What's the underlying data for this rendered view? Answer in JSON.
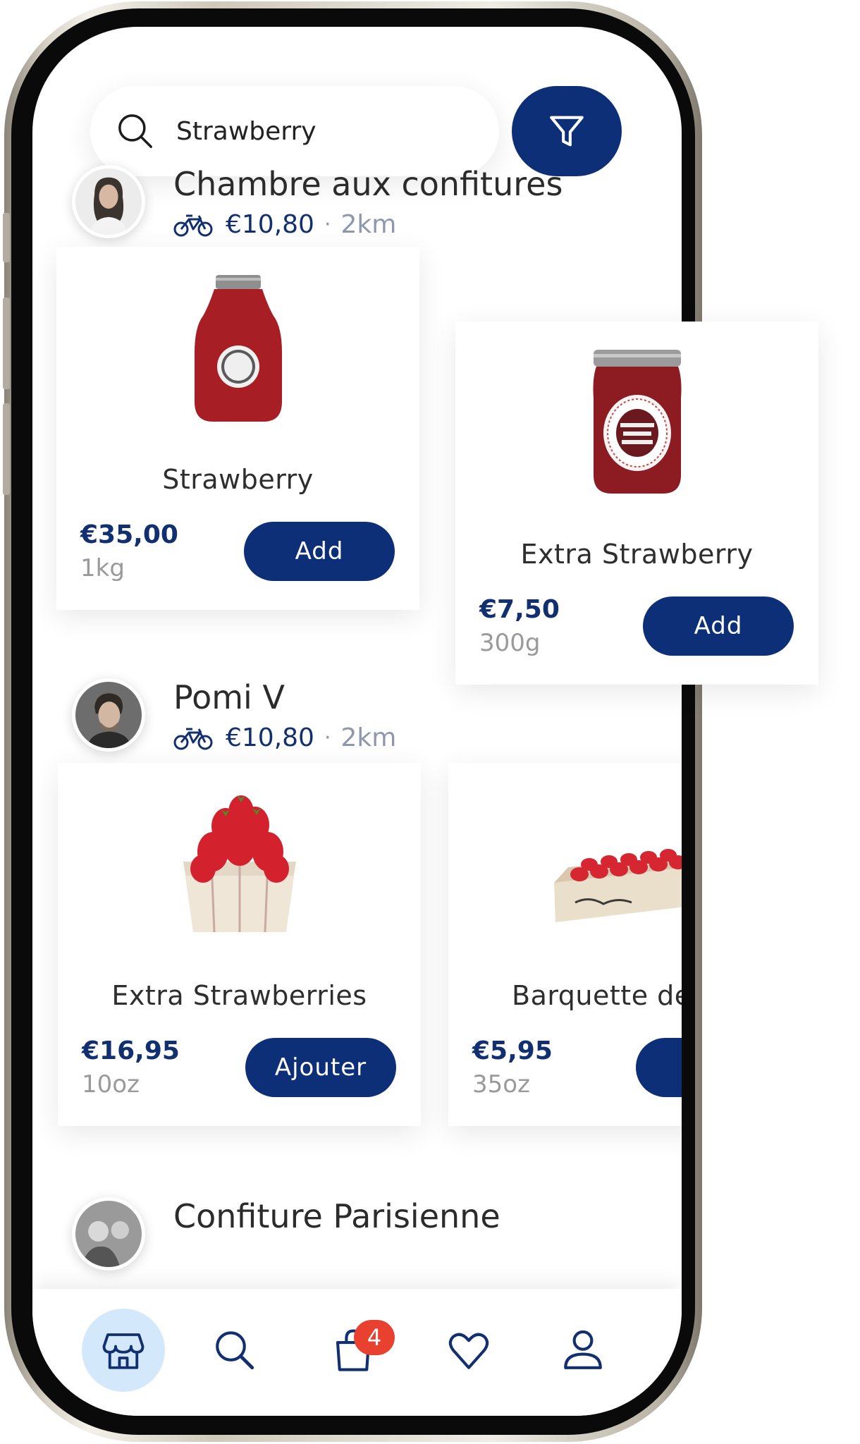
{
  "search": {
    "value": "Strawberry"
  },
  "shops": [
    {
      "name": "Chambre aux confitures",
      "delivery_fee": "€10,80",
      "separator": "·",
      "distance": "2km",
      "products": [
        {
          "name": "Strawberry",
          "price": "€35,00",
          "weight": "1kg",
          "button": "Add"
        },
        {
          "name": "Extra Strawberry",
          "price": "€7,50",
          "weight": "300g",
          "button": "Add"
        }
      ]
    },
    {
      "name": "Pomi V",
      "delivery_fee": "€10,80",
      "separator": "·",
      "distance": "2km",
      "products": [
        {
          "name": "Extra Strawberries",
          "price": "€16,95",
          "weight": "10oz",
          "button": "Ajouter"
        },
        {
          "name": "Barquette de",
          "price": "€5,95",
          "weight": "35oz",
          "button": ""
        }
      ]
    },
    {
      "name": "Confiture Parisienne"
    }
  ],
  "tabbar": {
    "cart_badge": "4"
  },
  "colors": {
    "primary": "#0d2f78",
    "badge": "#e8412f",
    "active_tab_bg": "#d4e8fb"
  },
  "icons": [
    "search-icon",
    "filter-icon",
    "bicycle-icon",
    "shop-icon",
    "cart-icon",
    "heart-icon",
    "profile-icon"
  ]
}
